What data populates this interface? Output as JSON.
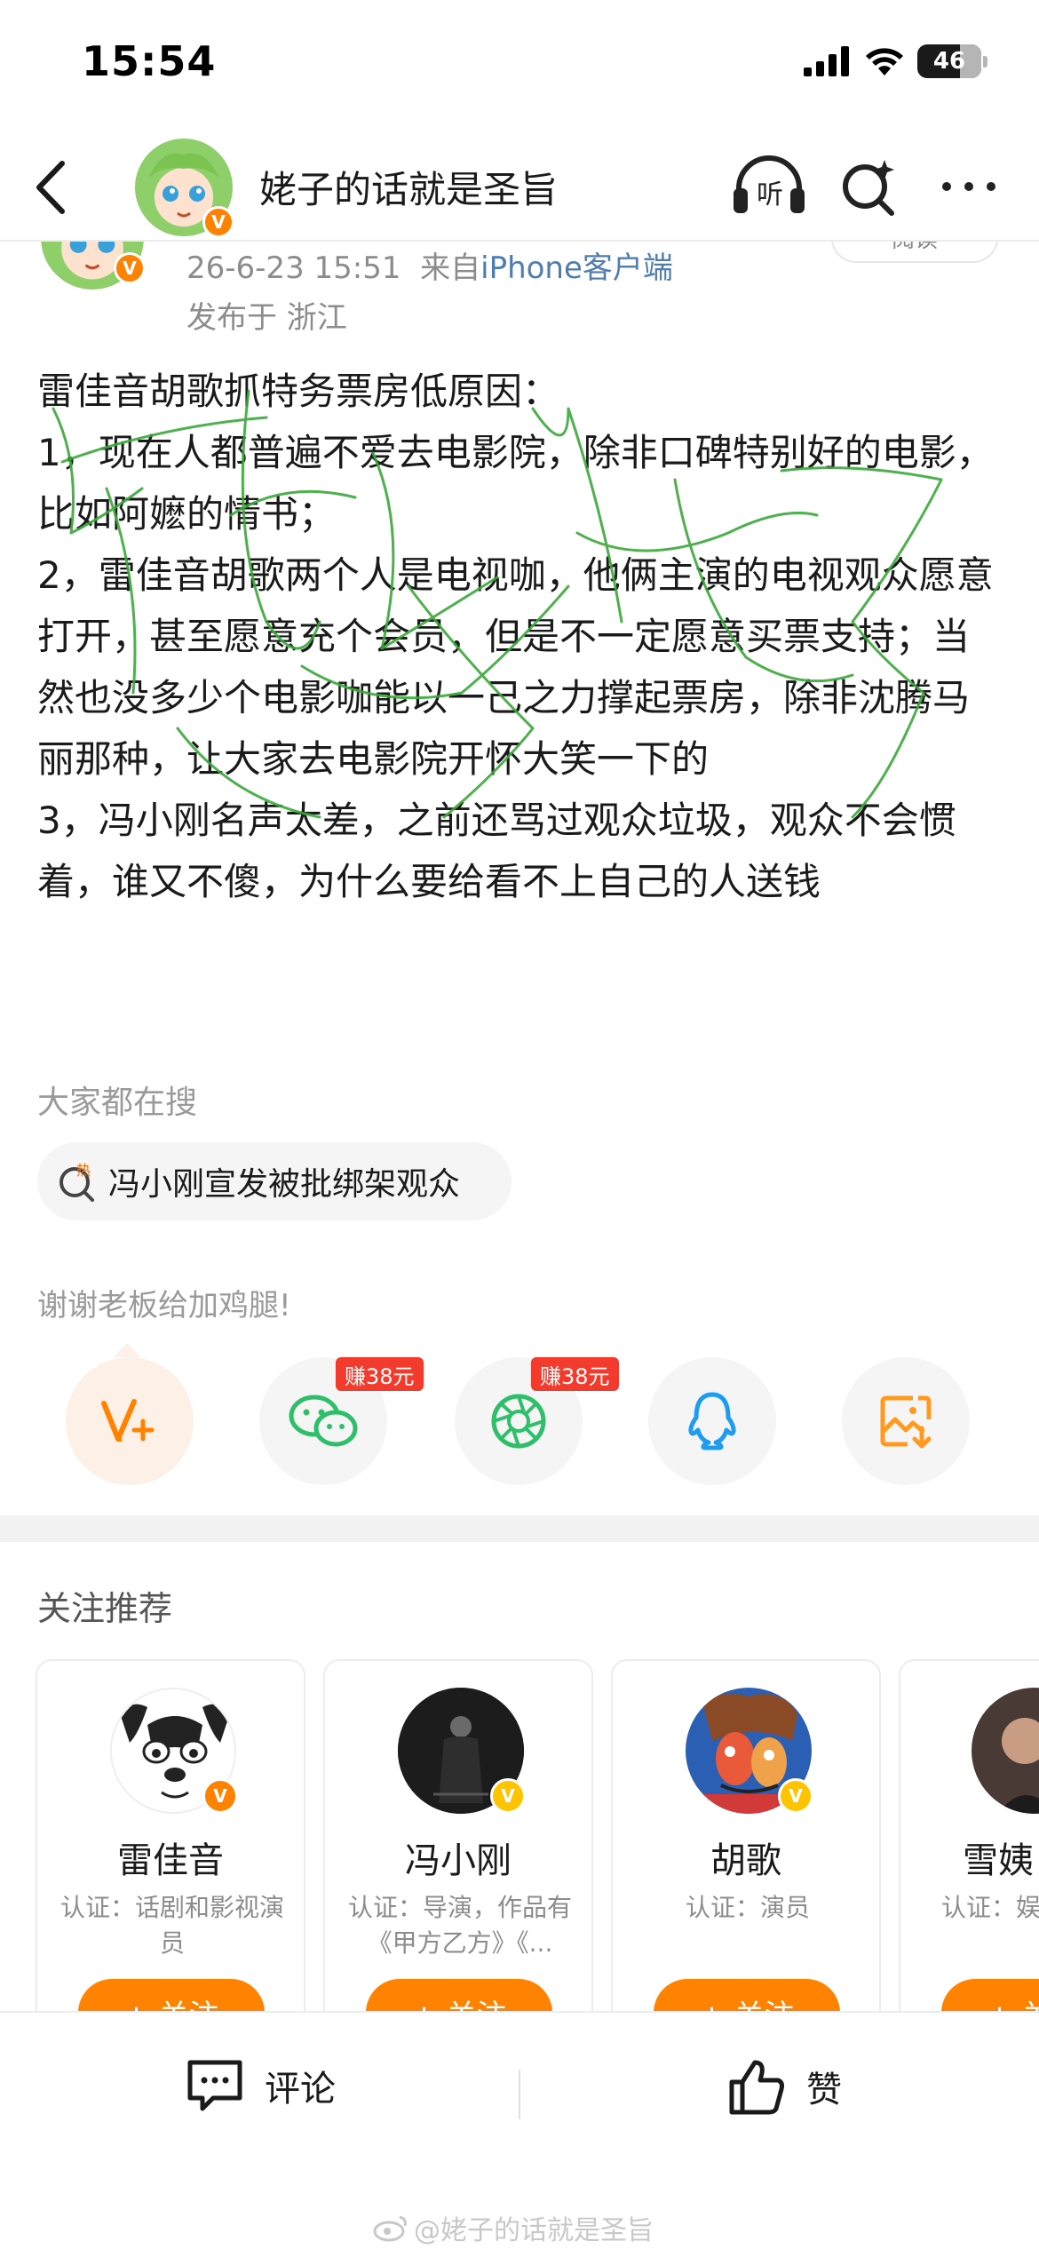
{
  "status_bar": {
    "time": "15:54",
    "battery": "46"
  },
  "header": {
    "title": "姥子的话就是圣旨",
    "listen_label": "听"
  },
  "post": {
    "meta": {
      "date": "26-6-23 15:51",
      "from_prefix": "来自",
      "source": "iPhone客户端",
      "location": "发布于 浙江",
      "read_label": "阅读"
    },
    "paragraphs": [
      "雷佳音胡歌抓特务票房低原因：",
      "1，现在人都普遍不爱去电影院，除非口碑特别好的电影，比如阿嬷的情书；",
      "2，雷佳音胡歌两个人是电视咖，他俩主演的电视观众愿意打开，甚至愿意充个会员，但是不一定愿意买票支持；当然也没多少个电影咖能以一己之力撑起票房，除非沈腾马丽那种，让大家去电影院开怀大笑一下的",
      "3，冯小刚名声太差，之前还骂过观众垃圾，观众不会惯着，谁又不傻，为什么要给看不上自己的人送钱"
    ]
  },
  "search": {
    "label": "大家都在搜",
    "hot_tag": "热",
    "hot_item": "冯小刚宣发被批绑架观众"
  },
  "reward": {
    "label": "谢谢老板给加鸡腿!"
  },
  "share": {
    "earn_badge_1": "赚38元",
    "earn_badge_2": "赚38元",
    "icons": [
      "vplus-icon",
      "wechat-icon",
      "moments-icon",
      "qq-icon",
      "save-image-icon"
    ],
    "colors": {
      "orange": "#ff8200",
      "green": "#2fbf6b",
      "blue": "#1e9cf0",
      "red": "#f23b2c"
    }
  },
  "recommend": {
    "title": "关注推荐",
    "follow_label": "+ 关注",
    "cards": [
      {
        "name": "雷佳音",
        "desc": "认证：话剧和影视演员"
      },
      {
        "name": "冯小刚",
        "desc": "认证：导演，作品有《甲方乙方》《..."
      },
      {
        "name": "胡歌",
        "desc": "认证：演员"
      },
      {
        "name": "雪姨",
        "desc": "认证：娱"
      }
    ]
  },
  "bottom_bar": {
    "comment_label": "评论",
    "like_label": "赞",
    "watermark": "@姥子的话就是圣旨"
  }
}
